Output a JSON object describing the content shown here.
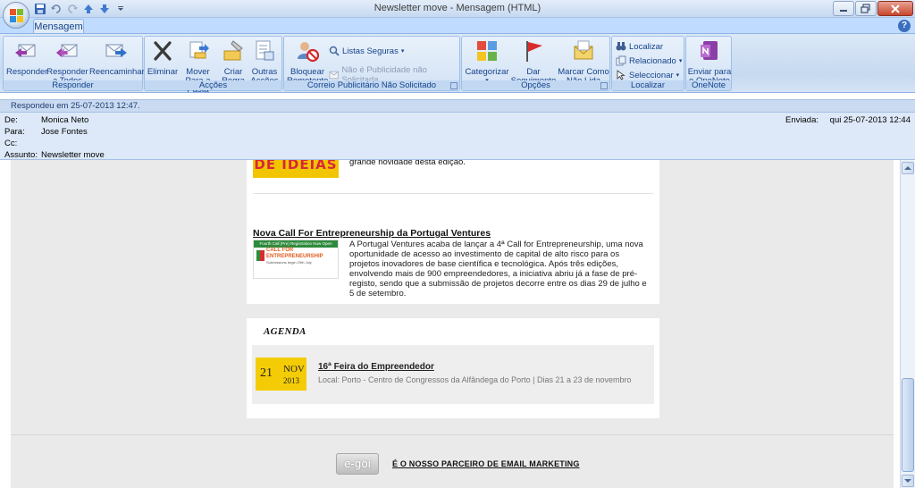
{
  "window": {
    "title": "Newsletter move  -  Mensagem (HTML)"
  },
  "ribbon": {
    "tab_active": "Mensagem",
    "groups": {
      "responder": {
        "title": "Responder",
        "buttons": [
          "Responder",
          "Responder a Todos",
          "Reencaminhar"
        ]
      },
      "accoes": {
        "title": "Acções",
        "eliminar": "Eliminar",
        "mover": "Mover Para a Pasta",
        "criar": "Criar Regra",
        "outras": "Outras Acções"
      },
      "correio": {
        "title": "Correio Publicitário Não Solicitado",
        "bloquear": "Bloquear Remetente",
        "listas": "Listas Seguras",
        "nao_pub": "Não é Publicidade não Solicitada"
      },
      "opcoes": {
        "title": "Opções",
        "categorizar": "Categorizar",
        "dar": "Dar Seguimento",
        "marcar": "Marcar Como Não Lida"
      },
      "localizar": {
        "title": "Localizar",
        "localizar": "Localizar",
        "relacionado": "Relacionado",
        "seleccionar": "Seleccionar"
      },
      "onenote": {
        "title": "OneNote",
        "enviar": "Enviar para o OneNote"
      }
    }
  },
  "info_bar": "Respondeu em 25-07-2013 12:47.",
  "headers": {
    "de_label": "De:",
    "de": "Monica Neto",
    "para_label": "Para:",
    "para": "Jose Fontes",
    "cc_label": "Cc:",
    "cc": "",
    "assunto_label": "Assunto:",
    "assunto": "Newsletter move",
    "enviada_label": "Enviada:",
    "enviada": "qui 25-07-2013 12:44"
  },
  "email": {
    "ideas_banner": "DE IDEIAS",
    "ideas_caption": "grande novidade desta edição.",
    "news": {
      "title": "Nova Call For Entrepreneurship da Portugal Ventures",
      "thumb_band": "Fourth Call (Pre) Registration Now Open",
      "thumb_title_1": "CALL FOR",
      "thumb_title_2": "ENTREPRENEURSHIP",
      "thumb_caption": "Submissions begin 29th July",
      "body": "A Portugal Ventures acaba de lançar a 4ª Call for Entrepreneurship, uma nova oportunidade de acesso ao investimento de capital de alto risco para os projetos inovadores de base científica e tecnológica. Após três edições, envolvendo mais de 900 empreendedores, a iniciativa abriu já a fase de pré-registo, sendo que a submissão de projetos decorre entre os dias 29 de julho e 5 de setembro."
    },
    "agenda": {
      "heading": "AGENDA",
      "event": {
        "day": "21",
        "month": "NOV",
        "year": "2013",
        "title": "16ª Feira do Empreendedor",
        "location": "Local: Porto - Centro de Congressos da Alfândega do Porto | Dias 21 a 23 de novembro"
      }
    },
    "footer": {
      "logo": "e-goi",
      "partner": "É O NOSSO PARCEIRO DE EMAIL MARKETING"
    }
  },
  "colors": {
    "ribbon_text": "#15428b",
    "accent_yellow": "#f4cc05",
    "banner_red": "#d8273b"
  }
}
